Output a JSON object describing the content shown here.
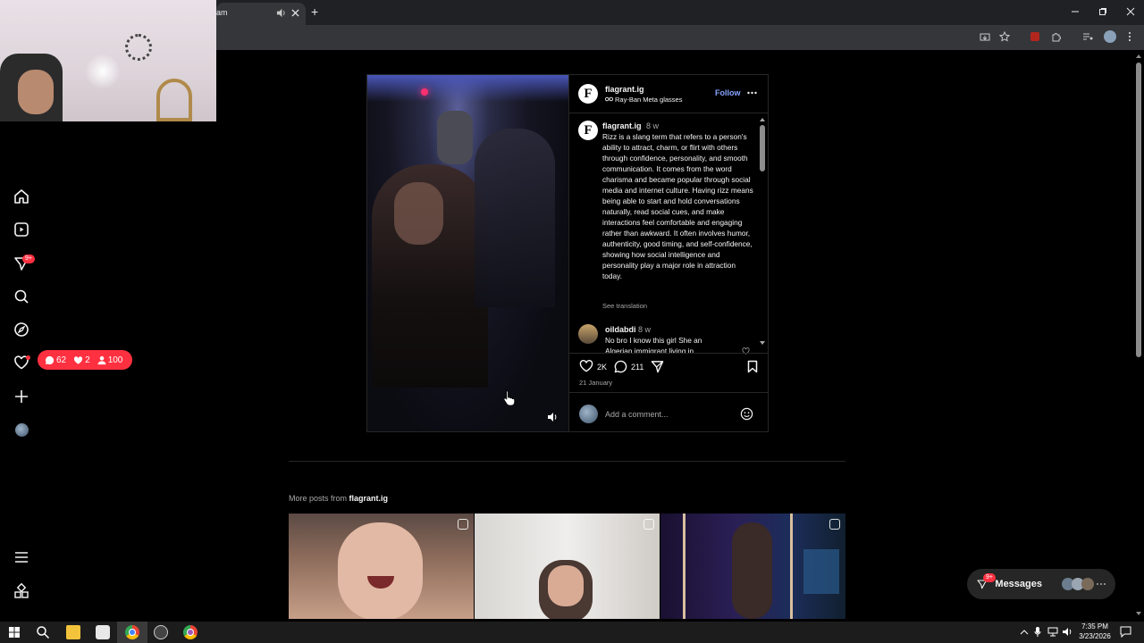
{
  "browser": {
    "tab_title": "am",
    "new_tab_symbol": "+",
    "window_controls": [
      "minimize-icon",
      "restore-icon",
      "close-icon"
    ]
  },
  "sidebar": {
    "items": [
      {
        "icon": "home-icon"
      },
      {
        "icon": "reels-icon"
      },
      {
        "icon": "messages-icon",
        "badge": "9+"
      },
      {
        "icon": "search-icon"
      },
      {
        "icon": "explore-icon"
      },
      {
        "icon": "notifications-icon"
      },
      {
        "icon": "create-icon"
      },
      {
        "icon": "profile-avatar"
      }
    ],
    "notification_summary": {
      "comments": "62",
      "likes": "2",
      "follows": "100"
    },
    "bottom": [
      {
        "icon": "menu-icon"
      },
      {
        "icon": "more-apps-icon"
      }
    ]
  },
  "post": {
    "author": "flagrant.ig",
    "author_initial": "F",
    "subtitle": "Ray-Ban Meta glasses",
    "follow_label": "Follow",
    "caption_author": "flagrant.ig",
    "caption_time": "8 w",
    "caption": "Rizz is a slang term that refers to a person's ability to attract, charm, or flirt with others through confidence, personality, and smooth communication. It comes from the word charisma and became popular through social media and internet culture. Having rizz means being able to start and hold conversations naturally, read social cues, and make interactions feel comfortable and engaging rather than awkward. It often involves humor, authenticity, good timing, and self-confidence, showing how social intelligence and personality play a major role in attraction today.",
    "see_translation": "See translation",
    "comment": {
      "user": "oildabdi",
      "time": "8 w",
      "text": "No bro I know this girl She an Algerian immigrant living in"
    },
    "likes": "2K",
    "comments": "211",
    "date": "21 January",
    "add_comment_placeholder": "Add a comment..."
  },
  "more_posts": {
    "label_prefix": "More posts from",
    "account": "flagrant.ig"
  },
  "messages_button": {
    "label": "Messages",
    "badge": "9+"
  },
  "taskbar": {
    "time": "7:35 PM",
    "date": "3/23/2026"
  },
  "colors": {
    "accent_link": "#0095f6",
    "follow": "#85a3ff",
    "badge": "#ff3040",
    "panel_border": "#262626"
  }
}
